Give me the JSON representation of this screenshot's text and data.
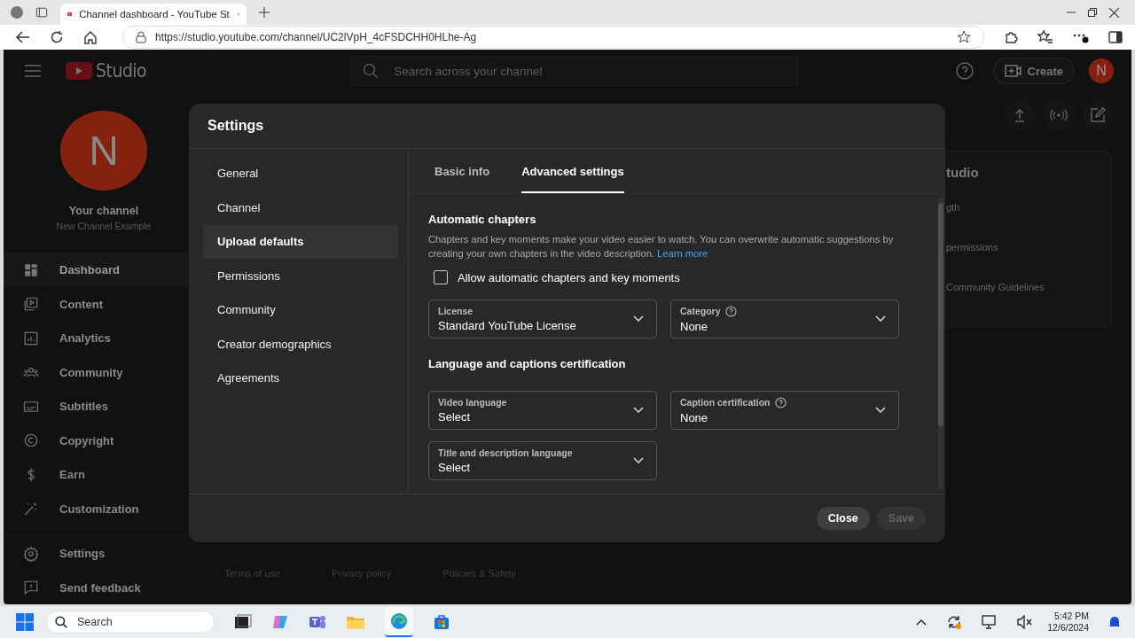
{
  "browser": {
    "tab_title": "Channel dashboard - YouTube St",
    "url": "https://studio.youtube.com/channel/UC2lVpH_4cFSDCHH0HLhe-Ag"
  },
  "studio": {
    "logo_text": "Studio",
    "search_placeholder": "Search across your channel",
    "create_label": "Create",
    "avatar_letter": "N",
    "channel": {
      "avatar_letter": "N",
      "title": "Your channel",
      "name": "New Channel Example"
    },
    "nav": [
      {
        "label": "Dashboard",
        "selected": true
      },
      {
        "label": "Content",
        "selected": false
      },
      {
        "label": "Analytics",
        "selected": false
      },
      {
        "label": "Community",
        "selected": false
      },
      {
        "label": "Subtitles",
        "selected": false
      },
      {
        "label": "Copyright",
        "selected": false
      },
      {
        "label": "Earn",
        "selected": false
      },
      {
        "label": "Customization",
        "selected": false
      }
    ],
    "bottom_nav": [
      "Settings",
      "Send feedback"
    ],
    "background_panel": {
      "title": "tudio",
      "rows": [
        "gth",
        "permissions",
        "Community Guidelines"
      ]
    },
    "footer_links": [
      "Terms of use",
      "Privacy policy",
      "Policies & Safety"
    ]
  },
  "dialog": {
    "title": "Settings",
    "nav": [
      {
        "label": "General",
        "selected": false
      },
      {
        "label": "Channel",
        "selected": false
      },
      {
        "label": "Upload defaults",
        "selected": true
      },
      {
        "label": "Permissions",
        "selected": false
      },
      {
        "label": "Community",
        "selected": false
      },
      {
        "label": "Creator demographics",
        "selected": false
      },
      {
        "label": "Agreements",
        "selected": false
      }
    ],
    "tabs": [
      {
        "label": "Basic info",
        "selected": false
      },
      {
        "label": "Advanced settings",
        "selected": true
      }
    ],
    "chapters": {
      "heading": "Automatic chapters",
      "description": "Chapters and key moments make your video easier to watch. You can overwrite automatic suggestions by creating your own chapters in the video description.",
      "link": "Learn more",
      "checkbox": {
        "label": "Allow automatic chapters and key moments",
        "checked": false
      }
    },
    "license_row": [
      {
        "label": "License",
        "value": "Standard YouTube License",
        "help": false
      },
      {
        "label": "Category",
        "value": "None",
        "help": true
      }
    ],
    "language_heading": "Language and captions certification",
    "language_rows": [
      [
        {
          "label": "Video language",
          "value": "Select",
          "help": false
        },
        {
          "label": "Caption certification",
          "value": "None",
          "help": true
        }
      ],
      [
        {
          "label": "Title and description language",
          "value": "Select",
          "help": false
        }
      ]
    ],
    "buttons": [
      {
        "label": "Close",
        "disabled": false
      },
      {
        "label": "Save",
        "disabled": true
      }
    ]
  },
  "taskbar": {
    "search_placeholder": "Search",
    "time": "5:42 PM",
    "date": "12/6/2024"
  }
}
